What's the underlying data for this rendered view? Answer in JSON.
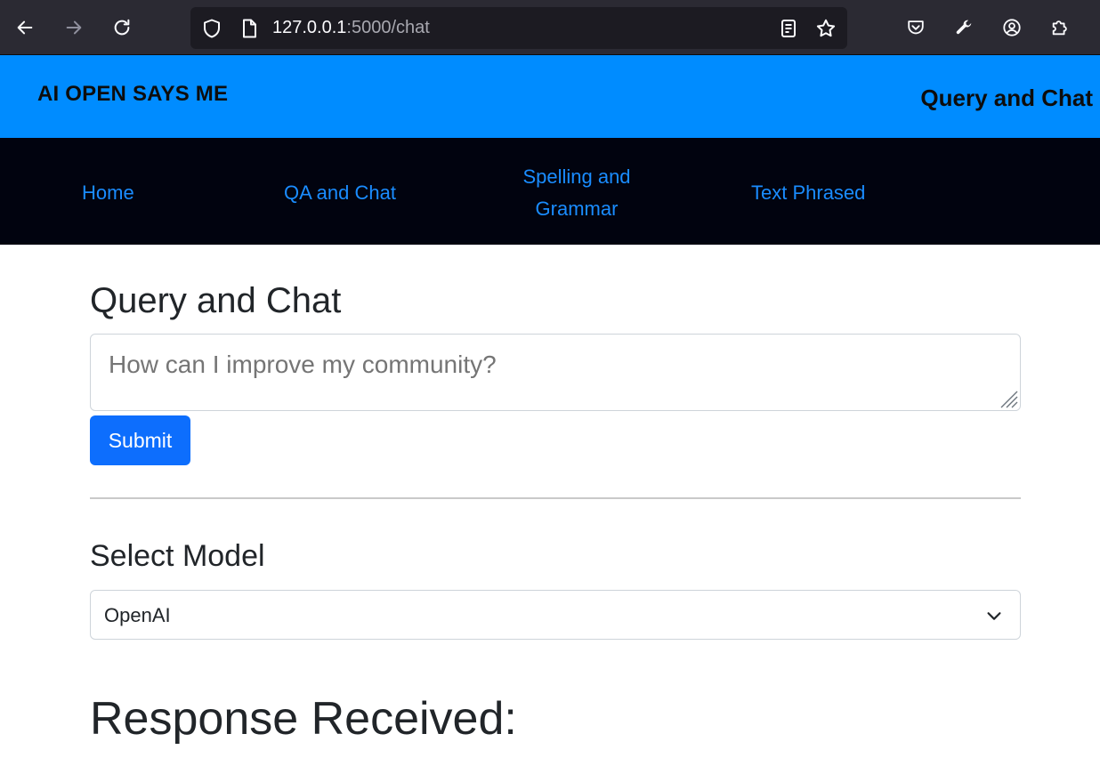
{
  "browser": {
    "url_host": "127.0.0.1",
    "url_path": ":5000/chat"
  },
  "header": {
    "brand": "AI OPEN SAYS ME",
    "page_title": "Query and Chat"
  },
  "nav": {
    "home": "Home",
    "qa_chat": "QA and Chat",
    "spelling_line1": "Spelling and",
    "spelling_line2": "Grammar",
    "text_phrased": "Text Phrased"
  },
  "main": {
    "title": "Query and Chat",
    "query_placeholder": "How can I improve my community?",
    "submit_label": "Submit",
    "select_label": "Select Model",
    "selected_model": "OpenAI",
    "response_title": "Response Received:"
  },
  "colors": {
    "header_bg": "#008cff",
    "nav_bg": "#01030f",
    "nav_link": "#1a8cff",
    "button_bg": "#0d6efd"
  }
}
